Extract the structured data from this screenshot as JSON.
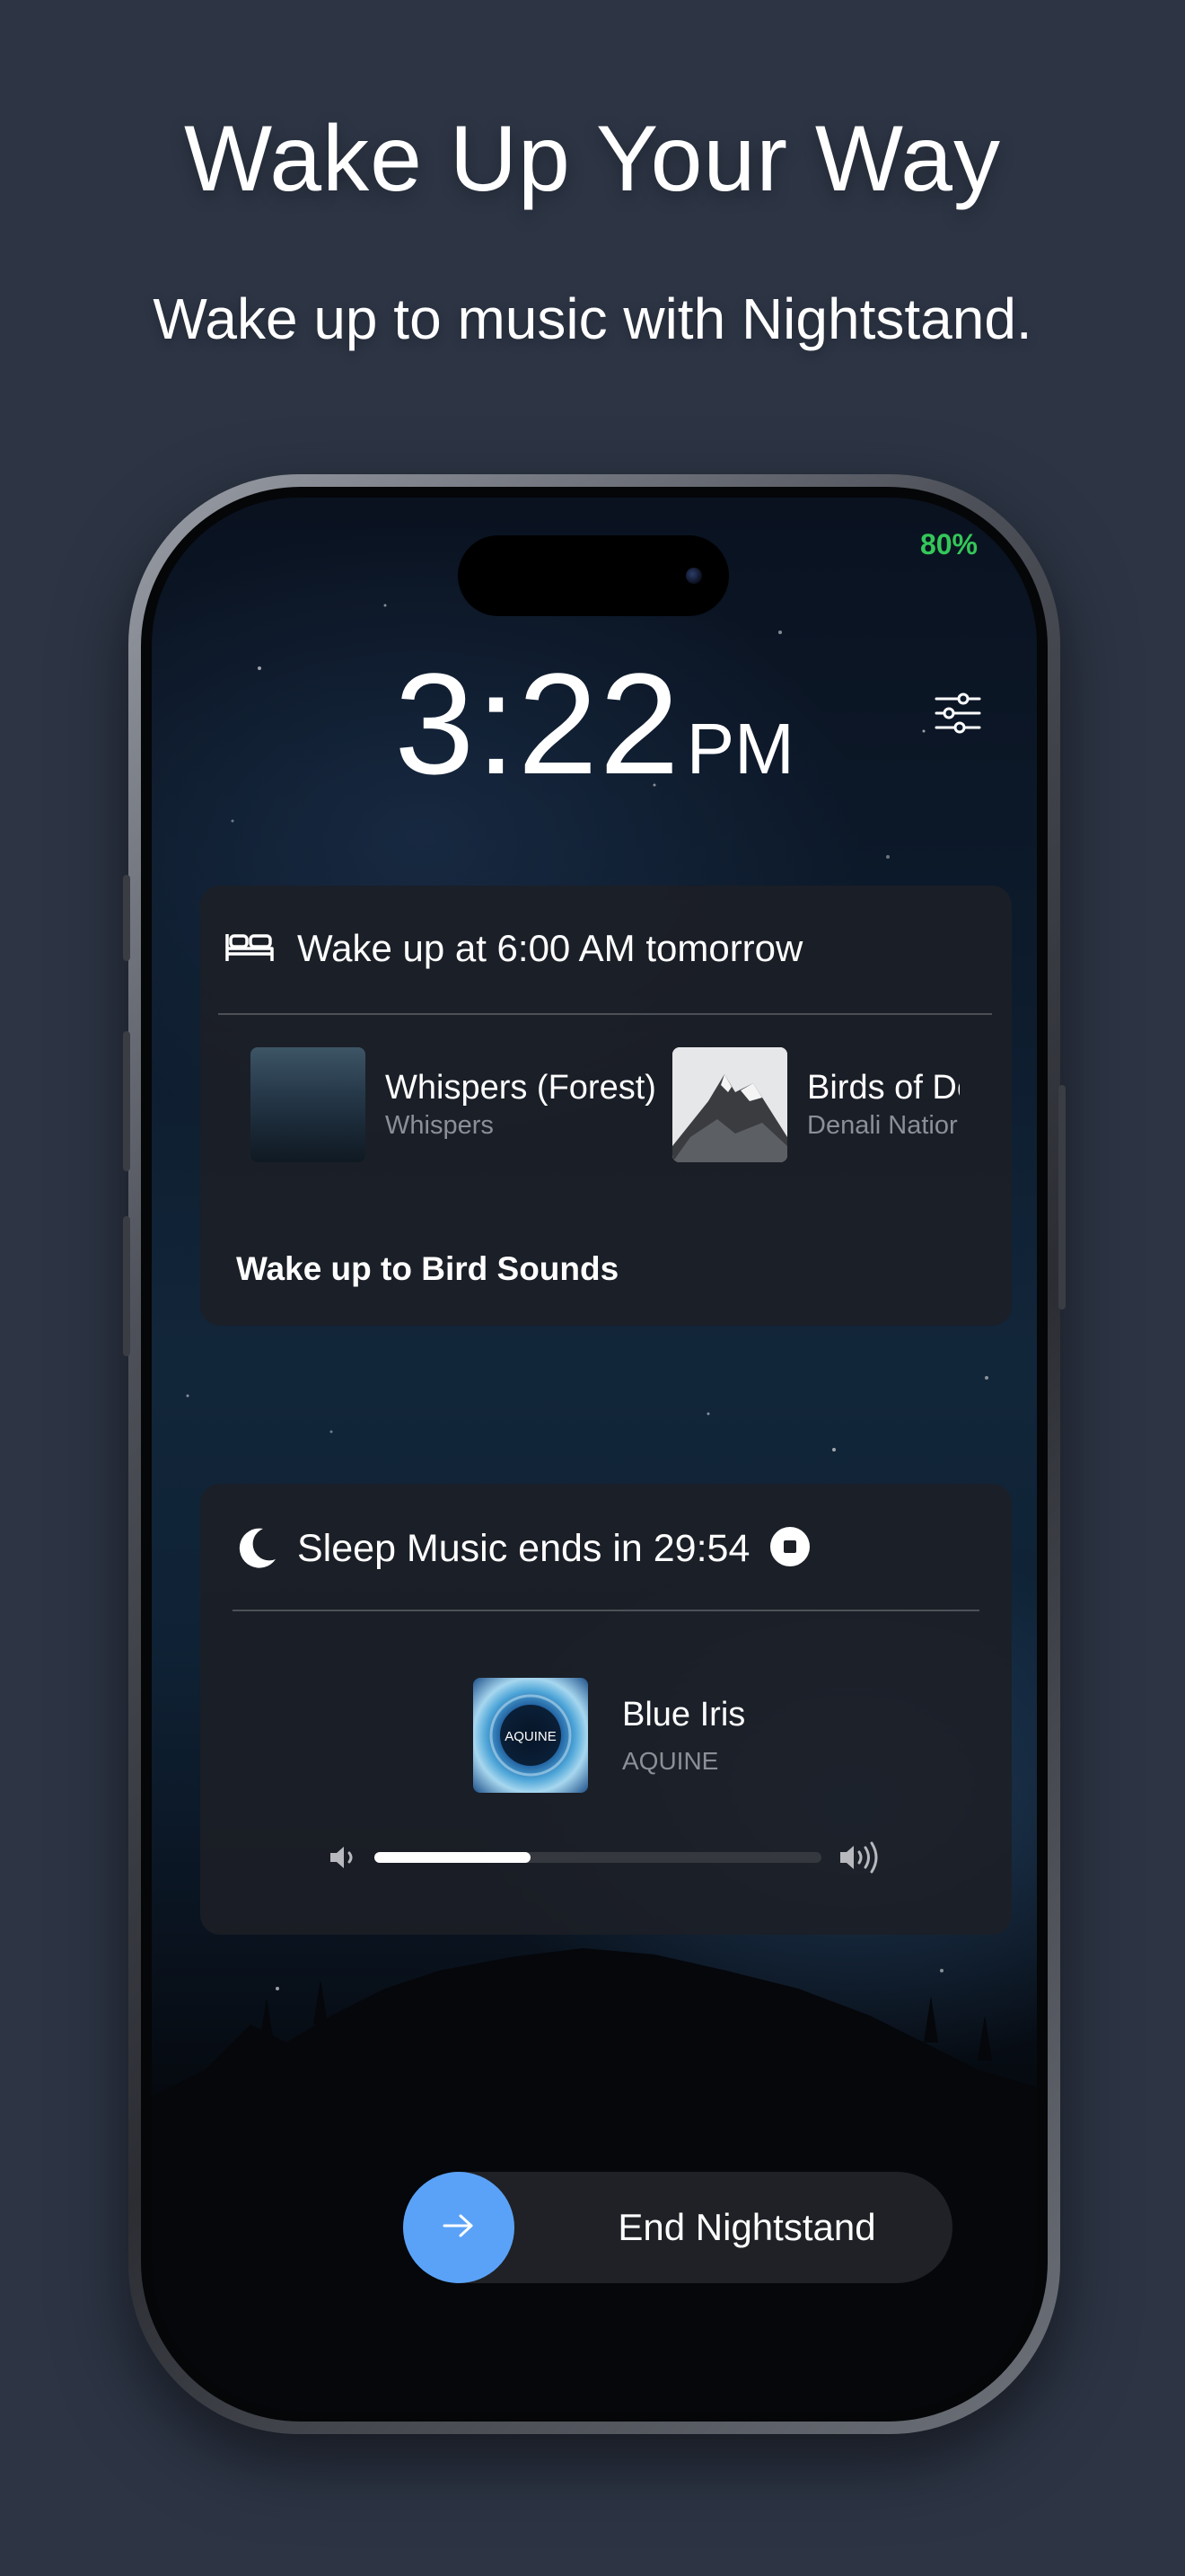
{
  "marketing": {
    "headline": "Wake Up Your Way",
    "subheadline": "Wake up to music with Nightstand."
  },
  "status_bar": {
    "battery": "80%",
    "battery_color": "#34c759"
  },
  "clock": {
    "time": "3:22",
    "period": "PM",
    "settings_icon": "sliders-icon"
  },
  "alarm": {
    "icon": "bed-icon",
    "label": "Wake up at 6:00 AM tomorrow",
    "tracks": [
      {
        "title": "Whispers (Forest)",
        "artist": "Whispers"
      },
      {
        "title": "Birds of De",
        "artist": "Denali Natior"
      }
    ],
    "sound_label": "Wake up to Bird Sounds"
  },
  "sleep": {
    "icon": "moon-icon",
    "label": "Sleep Music ends in 29:54",
    "stop_icon": "stop-icon",
    "now_playing": {
      "title": "Blue Iris",
      "artist": "AQUINE",
      "art_text": "AQUINE"
    },
    "volume_level": 0.35
  },
  "end_button": {
    "label": "End Nightstand",
    "icon": "arrow-right-icon",
    "accent": "#5aa2f7"
  }
}
